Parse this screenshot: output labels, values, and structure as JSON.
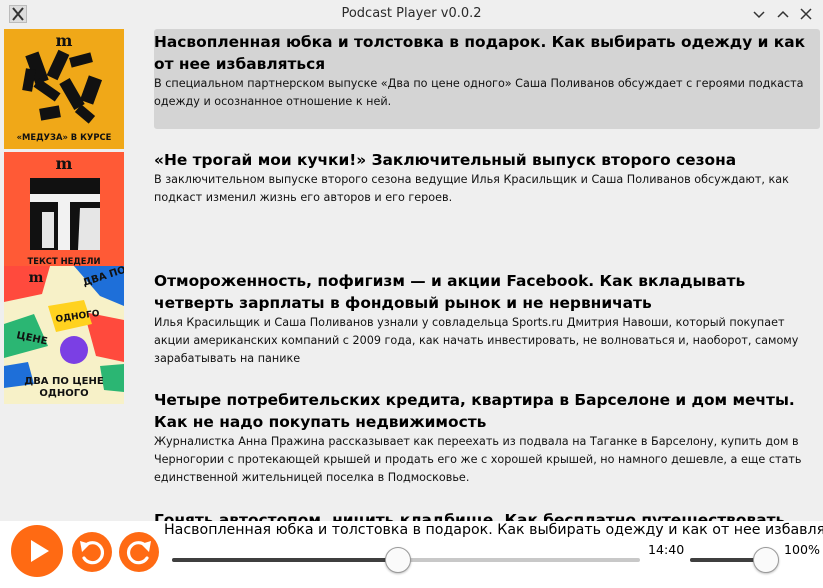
{
  "window": {
    "title": "Podcast Player v0.0.2",
    "app_icon": "x-app-icon",
    "controls": [
      "minimize-icon",
      "maximize-icon",
      "close-icon"
    ]
  },
  "episodes": [
    {
      "title": "Насвопленная юбка и толстовка в подарок. Как выбирать одежду и как от нее избавляться",
      "description": "В специальном партнерском выпуске «Два по цене одного» Саша Поливанов обсуждает с героями подкаста одежду и осознанное отношение к ней.",
      "selected": true
    },
    {
      "title": "«Не трогай мои кучки!» Заключительный выпуск второго сезона",
      "description": "В заключительном выпуске второго сезона ведущие Илья Красильщик и Саша Поливанов обсуждают, как подкаст изменил жизнь его авторов и его героев.",
      "selected": false
    },
    {
      "title": "Отмороженность, пофигизм — и акции Facebook. Как вкладывать четверть зарплаты в фондовый рынок и не нервничать",
      "description": "Илья Красильщик и Саша Поливанов узнали у совладельца Sports.ru Дмитрия Навоши, который покупает акции американских компаний с 2009 года, как начать инвестировать, не волноваться и, наоборот, самому зарабатывать на панике",
      "selected": false
    },
    {
      "title": "Четыре потребительских кредита, квартира в Барселоне и дом мечты. Как не надо покупать недвижимость",
      "description": "Журналистка Анна Пражина рассказывает как переехать из подвала на Таганке в Барселону, купить дом в Черногории с протекающей крышей и продать его же с хорошей крышей, но намного дешевле, а еще стать единственной жительницей поселка в Подмосковье.",
      "selected": false
    },
    {
      "title": "Гонять автостопом, ницить кладбище. Как бесплатно путешествовать",
      "description": "",
      "selected": false
    }
  ],
  "artworks": [
    {
      "logo": "m",
      "caption": "«МЕДУЗА» В КУРСЕ",
      "bg": "#f0a818"
    },
    {
      "logo": "m",
      "caption": "ТЕКСТ НЕДЕЛИ",
      "bg": "#ff5a36"
    },
    {
      "logo": "m",
      "caption_line1": "ДВА ПО ЦЕНЕ",
      "caption_line2": "ОДНОГО",
      "bg": "#f7f1c8",
      "sticker_words": [
        "ДВА ПО",
        "ЦЕНЕ",
        "ОДНОГО"
      ]
    }
  ],
  "player": {
    "now_playing": "Насвопленная юбка и толстовка в подарок. Как выбирать одежду и как от нее избавляться",
    "play_icon": "play-icon",
    "rewind_icon": "rewind-icon",
    "forward_icon": "forward-icon",
    "elapsed": "14:40",
    "progress": 0.482,
    "volume_label": "100%",
    "volume": 1.0,
    "accent": "#ff6a13"
  }
}
